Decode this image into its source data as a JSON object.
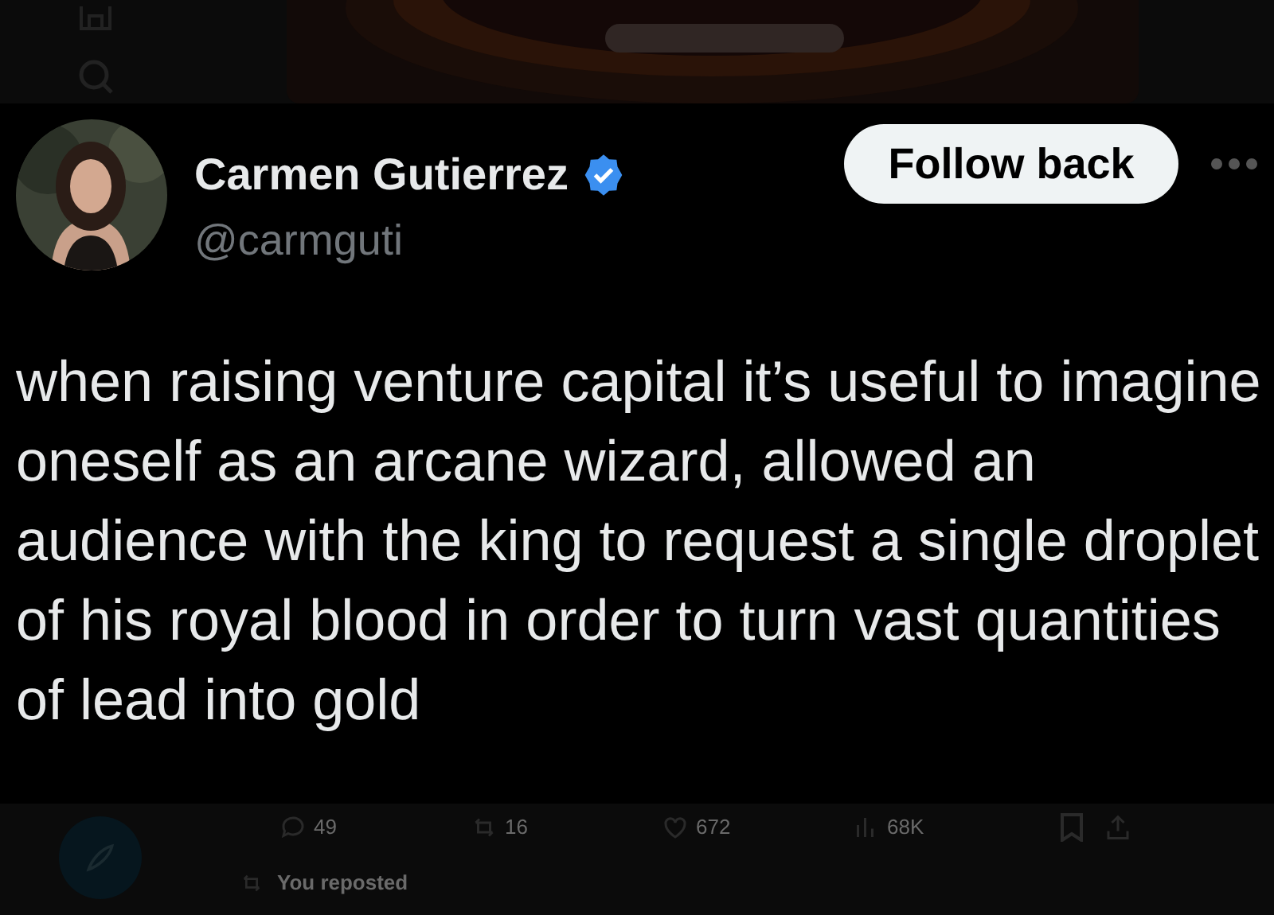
{
  "tweet": {
    "name": "Carmen Gutierrez",
    "verified": true,
    "handle": "@carmguti",
    "follow_button": "Follow back",
    "text": "when raising venture capital it’s useful to imagine oneself as an arcane wizard, allowed an audience with the king to request a single droplet of his royal blood in order to turn vast quantities of lead into gold"
  },
  "background_tweet": {
    "stats": [
      {
        "kind": "reply",
        "count": "49"
      },
      {
        "kind": "repost",
        "count": "16"
      },
      {
        "kind": "like",
        "count": "672"
      },
      {
        "kind": "views",
        "count": "68K"
      }
    ],
    "social_context": "You reposted"
  }
}
